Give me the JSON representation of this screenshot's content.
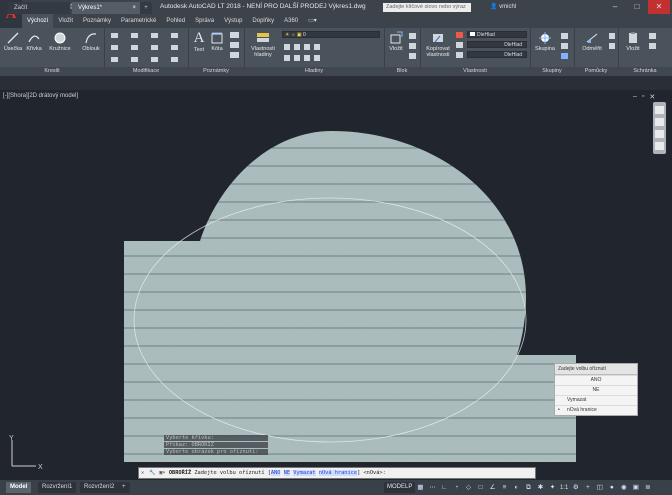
{
  "app": {
    "title": "Autodesk AutoCAD LT 2018 - NENÍ PRO DALŠÍ PRODEJ    Výkres1.dwg",
    "search_placeholder": "Zadejte klíčové slovo nebo výraz",
    "user": "vmichl"
  },
  "ribbon_tabs": [
    "Výchozí",
    "Vložit",
    "Poznámky",
    "Parametrické",
    "Pohled",
    "Správa",
    "Výstup",
    "Doplňky",
    "A360"
  ],
  "panels": {
    "draw": {
      "title": "Kreslit",
      "tools": [
        "Úsečka",
        "Křivka",
        "Kružnice",
        "Oblouk"
      ]
    },
    "modify": {
      "title": "Modifikace"
    },
    "annotation": {
      "title": "Poznámky",
      "tools": [
        "Text",
        "Kóta"
      ]
    },
    "layers": {
      "title": "Hladiny",
      "tool": "Vlastnosti hladiny",
      "layer_value": "0"
    },
    "block": {
      "title": "Blok",
      "tool": "Vložit"
    },
    "properties": {
      "title": "Vlastnosti",
      "tool": "Kopírovat vlastnosti",
      "combo1": "DleHlad",
      "combo2": "DleHlad",
      "combo3": "DleHlad"
    },
    "groups": {
      "title": "Skupiny",
      "tool": "Skupina"
    },
    "utilities": {
      "title": "Pomůcky",
      "tool": "Odměřit"
    },
    "clipboard": {
      "title": "Schránka",
      "tool": "Vložit"
    }
  },
  "doc_tabs": [
    "Začít",
    "Výkres1*",
    "+"
  ],
  "viewport_label": "[-][Shora][2D drátový model]",
  "context_menu": {
    "header": "Zadejte volbu oříznutí",
    "items": [
      "ANO",
      "NE",
      "Vymazat",
      "nOvá hranice"
    ],
    "selected": "nOvá hranice"
  },
  "command_history": [
    "Vyberte křivku:",
    "Příkaz: OBROŘÍŽ",
    "Vyberte obrázek pro oříznutí:"
  ],
  "command_line": {
    "prefix": "OBROŘÍŽ",
    "prompt": "Zadejte volbu oříznutí [",
    "options": [
      "ANO",
      "NE",
      "Vymazat",
      "nOvá hranice"
    ],
    "suffix": "] <nOvá>:"
  },
  "layout_tabs": [
    "Model",
    "Rozvržení1",
    "Rozvržení2",
    "+"
  ],
  "status": {
    "space": "MODELP",
    "scale": "1:1"
  },
  "colors": {
    "accent": "#1e5fb4",
    "background": "#21262e",
    "hatch_base": "#9fb3b4"
  }
}
